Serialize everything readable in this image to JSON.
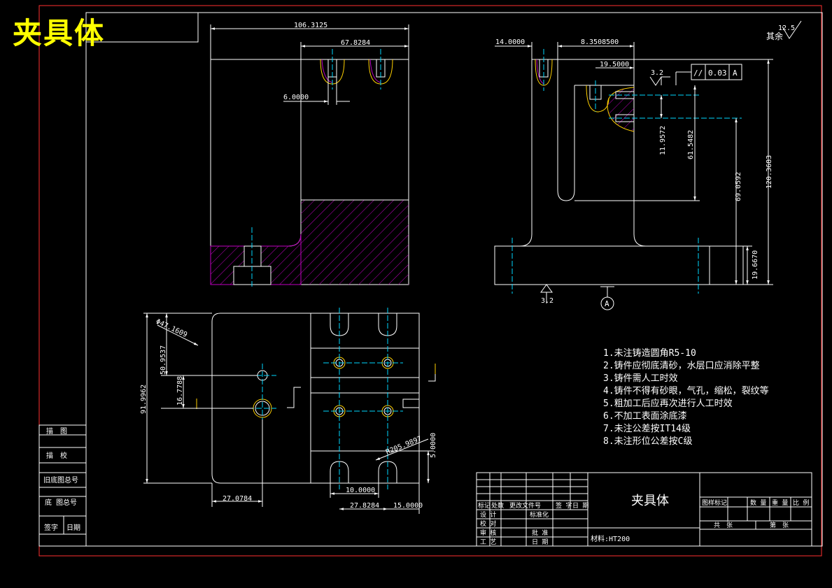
{
  "header": {
    "title": "夹具体"
  },
  "dimensions": {
    "top_width": "106.3125",
    "top_inner": "67.8284",
    "slot_width": "6.0000",
    "side_left": "14.0000",
    "side_top": "8.3508500",
    "side_inner": "19.5000",
    "v_small": "11.9572",
    "v_mid": "61.5482",
    "v_big": "69.0592",
    "v_total": "120.3683",
    "v_base": "19.6670",
    "bot_dia": "Φ47.1609",
    "bot_h1": "50.9537",
    "bot_h2": "16.7788",
    "bot_total": "91.9962",
    "bot_r": "R205.9897",
    "bot_5": "5.0000",
    "bot_w1": "27.0784",
    "bot_w2": "10.0000",
    "bot_w3": "27.8284",
    "bot_w4": "15.0000"
  },
  "symbols": {
    "roughness_tl": "12.5",
    "roughness_tl_label": "其余",
    "roughness_side": "3.2",
    "roughness_base": "3.2",
    "tolerance_symbol": "//",
    "tolerance_value": "0.03",
    "datum": "A",
    "datum_base": "A"
  },
  "notes": [
    "1.未注铸造圆角R5-10",
    "2.铸件应彻底清砂，水层口应消除平整",
    "3.铸件需人工时效",
    "4.铸件不得有砂眼，气孔，缩松，裂纹等",
    "5.粗加工后应再次进行人工时效",
    "6.不加工表面涂底漆",
    "7.未注公差按IT14级",
    "8.未注形位公差按C级"
  ],
  "side_table": [
    "描　图",
    "描　校",
    "旧底图总号",
    "底 图总号",
    "签字",
    "日期"
  ],
  "title_block": {
    "part_name": "夹具体",
    "material": "材料:HT200",
    "rev_headers": [
      "标记",
      "处数",
      "更改文件号",
      "签 字",
      "日 期"
    ],
    "roles": [
      "设 计",
      "校 对",
      "审 核",
      "工 艺"
    ],
    "std": "标准化",
    "approve": "批 准",
    "date": "日 期",
    "right_headers": [
      "图样标记",
      "数 量",
      "重 量",
      "比 例"
    ],
    "sheets": [
      "共　张",
      "第　张"
    ]
  },
  "colors": {
    "line": "#ffffff",
    "center": "#00d8ff",
    "hatch": "#c000c0",
    "frame": "#ff3030",
    "title": "#ffff00",
    "thread": "#ffd000"
  }
}
